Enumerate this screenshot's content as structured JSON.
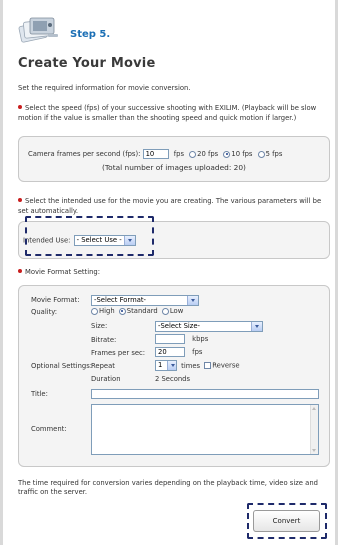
{
  "header": {
    "step_label": "Step 5.",
    "page_title": "Create Your Movie",
    "icon": "camera-photos-icon"
  },
  "intro": "Set the required information for movie conversion.",
  "speed_note": "Select the speed (fps) of your successive shooting with EXILIM. (Playback will be slow motion if the value is smaller than the shooting speed and quick motion if larger.)",
  "speed_panel": {
    "label": "Camera frames per second (fps):",
    "value": "10",
    "unit": "fps",
    "options": [
      {
        "label": "20 fps",
        "selected": false
      },
      {
        "label": "10 fps",
        "selected": true
      },
      {
        "label": "5 fps",
        "selected": false
      }
    ],
    "uploaded": "(Total number of images uploaded: 20)"
  },
  "use_note": "Select the intended use for the movie you are creating. The various parameters will be set automatically.",
  "use_panel": {
    "label": "Intended Use:",
    "selected": "- Select Use -"
  },
  "format_heading": "Movie Format Setting:",
  "format_panel": {
    "movie_format_label": "Movie Format:",
    "movie_format_value": "-Select Format-",
    "quality_label": "Quality:",
    "quality_options": [
      {
        "label": "High",
        "selected": false
      },
      {
        "label": "Standard",
        "selected": true
      },
      {
        "label": "Low",
        "selected": false
      }
    ],
    "size_label": "Size:",
    "size_value": "-Select Size-",
    "bitrate_label": "Bitrate:",
    "bitrate_value": "",
    "bitrate_unit": "kbps",
    "fps_label": "Frames per sec:",
    "fps_value": "20",
    "fps_unit": "fps",
    "optional_label": "Optional Settings:",
    "repeat_label": "Repeat",
    "repeat_value": "1",
    "times_label": "times",
    "reverse_label": "Reverse",
    "duration_label": "Duration",
    "duration_value": "2 Seconds",
    "title_label": "Title:",
    "title_value": "",
    "comment_label": "Comment:",
    "comment_value": ""
  },
  "footer_note": "The time required for conversion varies depending on the playback time, video size and traffic on the server.",
  "convert_label": "Convert",
  "colors": {
    "accent_blue": "#1b6fb5",
    "bullet_red": "#c81e1e",
    "dash_navy": "#1e2a6a"
  }
}
